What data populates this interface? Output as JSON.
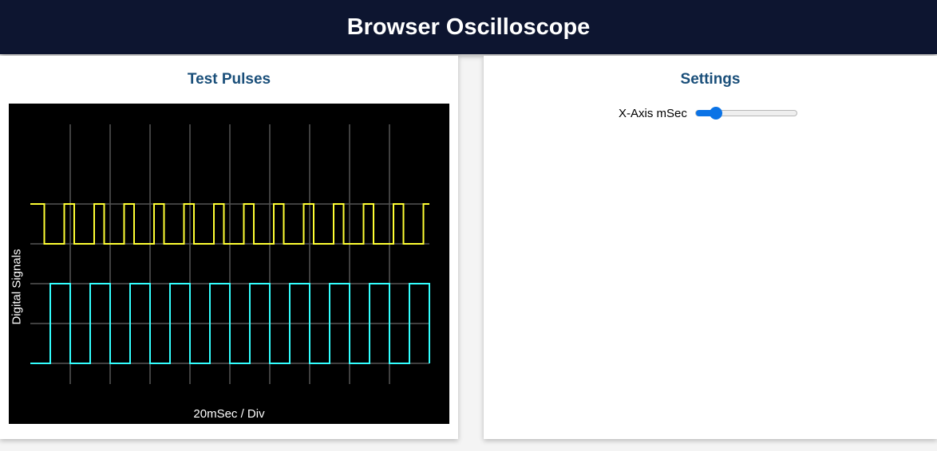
{
  "header": {
    "title": "Browser Oscilloscope"
  },
  "scope_panel": {
    "title": "Test Pulses"
  },
  "settings_panel": {
    "title": "Settings",
    "xaxis_slider": {
      "label": "X-Axis mSec",
      "value_fraction": 0.15
    }
  },
  "chart_data": {
    "type": "line",
    "title": "",
    "xlabel": "20mSec / Div",
    "ylabel": "Digital Signals",
    "grid": true,
    "xlim": [
      0,
      200
    ],
    "ylim": [
      0,
      6
    ],
    "x_divisions": 10,
    "y_divisions": 6,
    "series": [
      {
        "color": "#ffff33",
        "points": [
          [
            0,
            5
          ],
          [
            7,
            5
          ],
          [
            7,
            4
          ],
          [
            17,
            4
          ],
          [
            17,
            5
          ],
          [
            22,
            5
          ],
          [
            22,
            4
          ],
          [
            32,
            4
          ],
          [
            32,
            5
          ],
          [
            37,
            5
          ],
          [
            37,
            4
          ],
          [
            47,
            4
          ],
          [
            47,
            5
          ],
          [
            52,
            5
          ],
          [
            52,
            4
          ],
          [
            62,
            4
          ],
          [
            62,
            5
          ],
          [
            67,
            5
          ],
          [
            67,
            4
          ],
          [
            77,
            4
          ],
          [
            77,
            5
          ],
          [
            82,
            5
          ],
          [
            82,
            4
          ],
          [
            92,
            4
          ],
          [
            92,
            5
          ],
          [
            97,
            5
          ],
          [
            97,
            4
          ],
          [
            107,
            4
          ],
          [
            107,
            5
          ],
          [
            112,
            5
          ],
          [
            112,
            4
          ],
          [
            122,
            4
          ],
          [
            122,
            5
          ],
          [
            127,
            5
          ],
          [
            127,
            4
          ],
          [
            137,
            4
          ],
          [
            137,
            5
          ],
          [
            142,
            5
          ],
          [
            142,
            4
          ],
          [
            152,
            4
          ],
          [
            152,
            5
          ],
          [
            157,
            5
          ],
          [
            157,
            4
          ],
          [
            167,
            4
          ],
          [
            167,
            5
          ],
          [
            172,
            5
          ],
          [
            172,
            4
          ],
          [
            182,
            4
          ],
          [
            182,
            5
          ],
          [
            187,
            5
          ],
          [
            187,
            4
          ],
          [
            197,
            4
          ],
          [
            197,
            5
          ],
          [
            200,
            5
          ]
        ]
      },
      {
        "color": "#33ffff",
        "points": [
          [
            0,
            1
          ],
          [
            10,
            1
          ],
          [
            10,
            3
          ],
          [
            20,
            3
          ],
          [
            20,
            1
          ],
          [
            30,
            1
          ],
          [
            30,
            3
          ],
          [
            40,
            3
          ],
          [
            40,
            1
          ],
          [
            50,
            1
          ],
          [
            50,
            3
          ],
          [
            60,
            3
          ],
          [
            60,
            1
          ],
          [
            70,
            1
          ],
          [
            70,
            3
          ],
          [
            80,
            3
          ],
          [
            80,
            1
          ],
          [
            90,
            1
          ],
          [
            90,
            3
          ],
          [
            100,
            3
          ],
          [
            100,
            1
          ],
          [
            110,
            1
          ],
          [
            110,
            3
          ],
          [
            120,
            3
          ],
          [
            120,
            1
          ],
          [
            130,
            1
          ],
          [
            130,
            3
          ],
          [
            140,
            3
          ],
          [
            140,
            1
          ],
          [
            150,
            1
          ],
          [
            150,
            3
          ],
          [
            160,
            3
          ],
          [
            160,
            1
          ],
          [
            170,
            1
          ],
          [
            170,
            3
          ],
          [
            180,
            3
          ],
          [
            180,
            1
          ],
          [
            190,
            1
          ],
          [
            190,
            3
          ],
          [
            200,
            3
          ],
          [
            200,
            1
          ]
        ]
      }
    ]
  }
}
